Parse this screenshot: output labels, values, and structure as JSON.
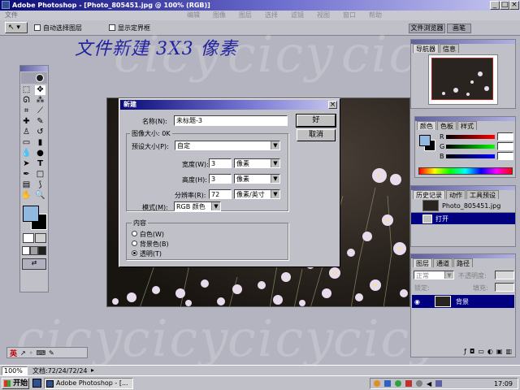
{
  "app": {
    "title": "Adobe Photoshop - [Photo_805451.jpg @ 100% (RGB)]",
    "menu_items": [
      "文件",
      "编辑",
      "图像",
      "图层",
      "选择",
      "滤镜",
      "视图",
      "窗口",
      "帮助"
    ]
  },
  "options_bar": {
    "checkbox1_label": "自动选择图层",
    "checkbox2_label": "显示定界框",
    "tab_file_browser": "文件浏览器",
    "tab_brushes": "画笔"
  },
  "handwritten_caption": "文件新建 3X3 像素",
  "watermark": "cicy",
  "dialog": {
    "title": "新建",
    "name_label": "名称(N):",
    "name_value": "未标题-3",
    "image_size_label": "图像大小: 0K",
    "preset_label": "预设大小(P):",
    "preset_value": "自定",
    "width_label": "宽度(W):",
    "width_value": "3",
    "width_unit": "像素",
    "height_label": "高度(H):",
    "height_value": "3",
    "height_unit": "像素",
    "resolution_label": "分辨率(R):",
    "resolution_value": "72",
    "resolution_unit": "像素/英寸",
    "mode_label": "模式(M):",
    "mode_value": "RGB 颜色",
    "contents_label": "内容",
    "contents_options": [
      "白色(W)",
      "背景色(B)",
      "透明(T)"
    ],
    "contents_selected": 2,
    "ok_label": "好",
    "cancel_label": "取消"
  },
  "navigator": {
    "tabs": [
      "导航器",
      "信息"
    ]
  },
  "color_panel": {
    "tabs": [
      "颜色",
      "色板",
      "样式"
    ],
    "channels": [
      "R",
      "G",
      "B"
    ],
    "values": [
      "",
      "",
      ""
    ]
  },
  "history_panel": {
    "tabs": [
      "历史记录",
      "动作",
      "工具预设"
    ],
    "snapshot": "Photo_805451.jpg",
    "items": [
      "打开"
    ]
  },
  "layers_panel": {
    "tabs": [
      "图层",
      "通道",
      "路径"
    ],
    "blend_mode": "正常",
    "opacity_label": "不透明度:",
    "fill_label": "填充:",
    "lock_label": "锁定:",
    "layer_name": "背景"
  },
  "status_bar": {
    "zoom": "100%",
    "doc_info": "文档:72/24/72/24"
  },
  "taskbar": {
    "start_label": "开始",
    "task_label": "Adobe Photoshop - [...",
    "clock": "17:09",
    "ime_label": "英"
  },
  "colors": {
    "title_dark": "#0a0a78",
    "selection": "#000080",
    "background": "#b4b4c0",
    "caption_ink": "#2020a0"
  }
}
